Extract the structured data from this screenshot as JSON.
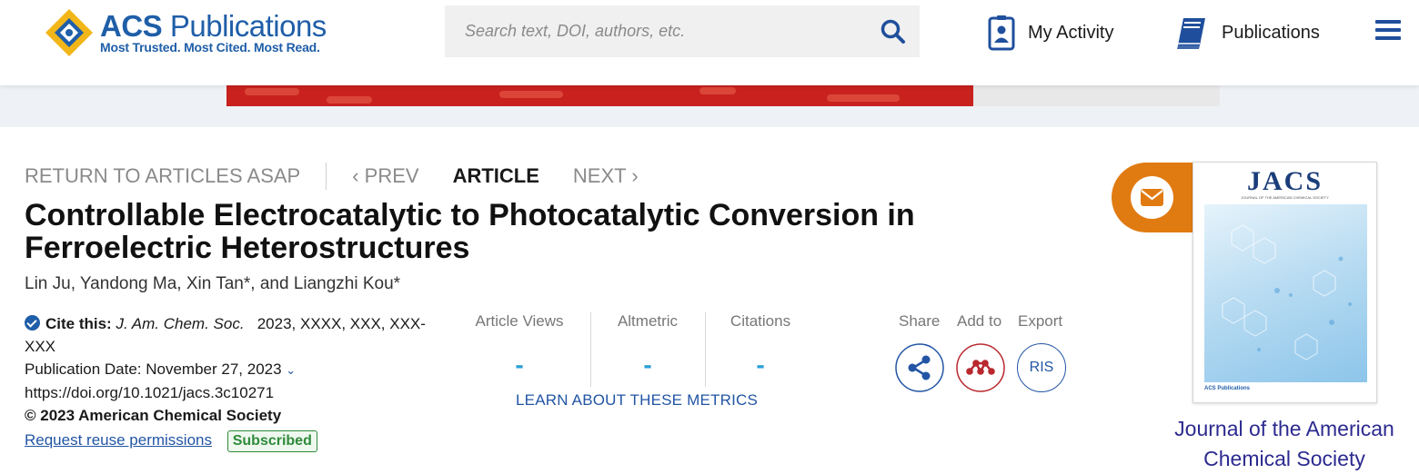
{
  "header": {
    "logo": {
      "brand_prefix": "ACS",
      "brand_suffix": "Publications",
      "tagline": "Most Trusted. Most Cited. Most Read.",
      "emblem_text": "ACS"
    },
    "search": {
      "placeholder": "Search text, DOI, authors, etc.",
      "value": ""
    },
    "nav": [
      {
        "label": "My Activity",
        "icon": "id-badge-icon"
      },
      {
        "label": "Publications",
        "icon": "book-icon"
      }
    ],
    "menu_icon": "hamburger-menu-icon"
  },
  "article_nav": {
    "return_label": "RETURN TO ARTICLES ASAP",
    "prev_label": "PREV",
    "current_label": "ARTICLE",
    "next_label": "NEXT"
  },
  "article": {
    "title": "Controllable Electrocatalytic to Photocatalytic Conversion in Ferroelectric Heterostructures",
    "authors": [
      "Lin Ju",
      "Yandong Ma",
      "Xin Tan*",
      "Liangzhi Kou*"
    ],
    "authors_sep": ", ",
    "authors_and": ", and ",
    "cite_label": "Cite this:",
    "journal_abbrev": "J. Am. Chem. Soc.",
    "citation_rest": "2023, XXXX, XXX, XXX-XXX",
    "pub_date": "Publication Date: November 27, 2023",
    "doi": "https://doi.org/10.1021/jacs.3c10271",
    "copyright": "© 2023 American Chemical Society",
    "reuse_label": "Request reuse permissions",
    "access_badge": "Subscribed"
  },
  "metrics": {
    "items": [
      {
        "label": "Article Views",
        "value": "-"
      },
      {
        "label": "Altmetric",
        "value": "-"
      },
      {
        "label": "Citations",
        "value": "-"
      }
    ],
    "learn_label": "LEARN ABOUT THESE METRICS"
  },
  "actions": {
    "share_label": "Share",
    "add_label": "Add to",
    "export_label": "Export",
    "export_format": "RIS"
  },
  "journal": {
    "cover_title": "JACS",
    "cover_subtitle": "JOURNAL OF THE AMERICAN CHEMICAL SOCIETY",
    "cover_footer": "ACS Publications",
    "name": "Journal of the American Chemical Society"
  },
  "colors": {
    "brand_blue": "#1f5ea8",
    "metric_blue": "#2a9fd8",
    "email_orange": "#e07b12",
    "addto_red": "#b8282e",
    "subscribed_green": "#2f8a3a",
    "journal_link": "#2c2a8f"
  }
}
